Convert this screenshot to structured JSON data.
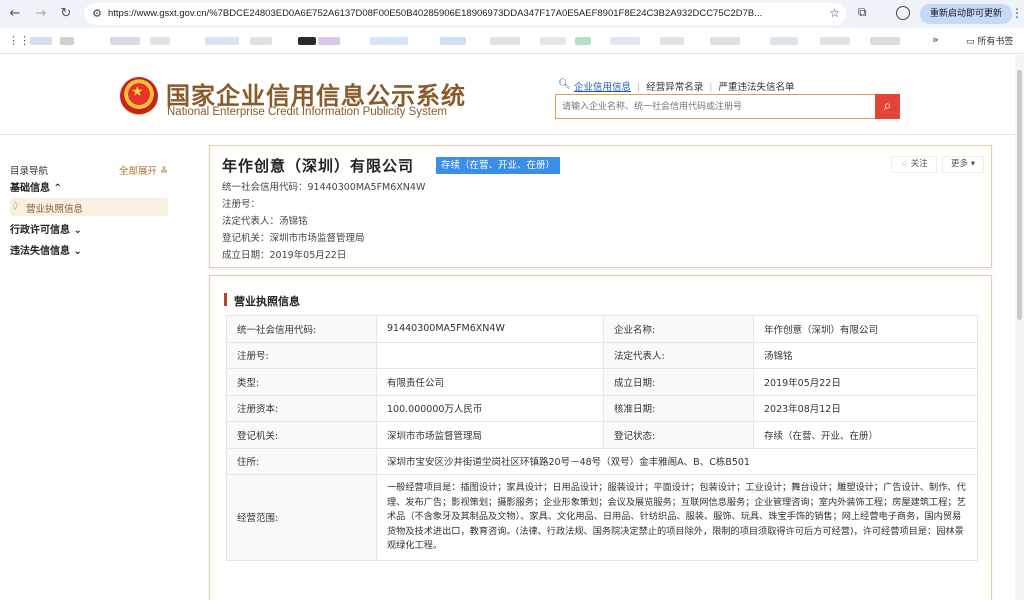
{
  "browser": {
    "url": "https://www.gsxt.gov.cn/%7BDCE24803ED0A6E752A6137D08F00E50B40285906E18906973DDA347F17A0E5AEF8901F8E24C3B2A932DCC75C2D7B...",
    "restart_label": "重新启动即可更新",
    "bookmarks_folder": "所有书签"
  },
  "header": {
    "title_cn": "国家企业信用信息公示系统",
    "title_en": "National Enterprise Credit Information Publicity System",
    "links": [
      "企业信用信息",
      "经营异常名录",
      "严重违法失信名单"
    ],
    "search_placeholder": "请输入企业名称、统一社会信用代码或注册号"
  },
  "sidebar": {
    "title": "目录导航",
    "expand_all": "全部展开",
    "groups": [
      {
        "label": "基础信息",
        "expanded": true,
        "items": [
          "营业执照信息"
        ]
      },
      {
        "label": "行政许可信息",
        "expanded": false
      },
      {
        "label": "违法失信信息",
        "expanded": false
      }
    ]
  },
  "company": {
    "name": "年作创意（深圳）有限公司",
    "status_badge": "存续（在营、开业、在册）",
    "follow_label": "关注",
    "more_label": "更多",
    "lines": [
      "统一社会信用代码：91440300MA5FM6XN4W",
      "注册号：",
      "法定代表人：汤锦铭",
      "登记机关：深圳市市场监督管理局",
      "成立日期：2019年05月22日"
    ]
  },
  "license": {
    "title": "营业执照信息",
    "rows": [
      [
        "统一社会信用代码:",
        "91440300MA5FM6XN4W",
        "企业名称:",
        "年作创意（深圳）有限公司"
      ],
      [
        "注册号:",
        "",
        "法定代表人:",
        "汤锦铭"
      ],
      [
        "类型:",
        "有限责任公司",
        "成立日期:",
        "2019年05月22日"
      ],
      [
        "注册资本:",
        "100.000000万人民币",
        "核准日期:",
        "2023年08月12日"
      ],
      [
        "登记机关:",
        "深圳市市场监督管理局",
        "登记状态:",
        "存续（在营、开业、在册）"
      ]
    ],
    "address_label": "住所:",
    "address": "深圳市宝安区沙井街道坣岗社区环镇路20号－48号（双号）金丰雅阁A、B、C栋B501",
    "scope_label": "经营范围:",
    "scope": "一般经营项目是：插图设计；家具设计；日用品设计；服装设计；平面设计；包装设计；工业设计；舞台设计；雕塑设计；广告设计、制作、代理、发布广告；影视策划；摄影服务；企业形象策划；会议及展览服务；互联网信息服务；企业管理咨询；室内外装饰工程；房屋建筑工程；艺术品（不含象牙及其制品及文物）、家具、文化用品、日用品、针纺织品、服装、服饰、玩具、珠宝手饰的销售；网上经营电子商务，国内贸易货物及技术进出口，教育咨询。(法律、行政法规、国务院决定禁止的项目除外，限制的项目须取得许可后方可经营)，许可经营项目是：园林景观绿化工程。"
  }
}
